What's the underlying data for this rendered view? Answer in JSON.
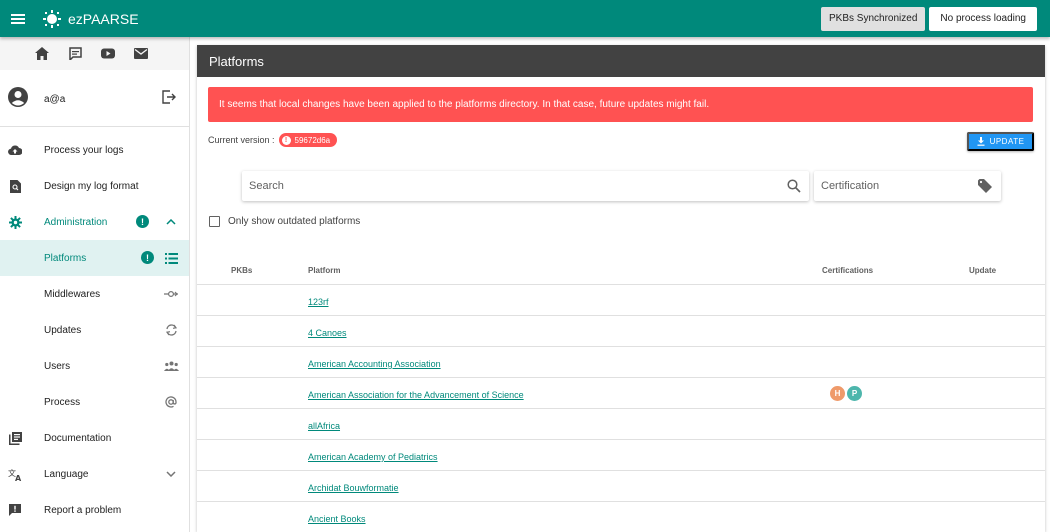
{
  "app": {
    "brand": "ezPAARSE",
    "pkbs_status": "PKBs Synchronized",
    "process_status": "No process loading"
  },
  "sidebar": {
    "user": "a@a",
    "items": [
      {
        "label": "Process your logs"
      },
      {
        "label": "Design my log format"
      },
      {
        "label": "Administration"
      },
      {
        "label": "Platforms"
      },
      {
        "label": "Middlewares"
      },
      {
        "label": "Updates"
      },
      {
        "label": "Users"
      },
      {
        "label": "Process"
      },
      {
        "label": "Documentation"
      },
      {
        "label": "Language"
      },
      {
        "label": "Report a problem"
      }
    ],
    "alert_mark": "!"
  },
  "main": {
    "title": "Platforms",
    "alert": "It seems that local changes have been applied to the platforms directory. In that case, future updates might fail.",
    "version_label": "Current version :",
    "version": "59672d6a",
    "version_mark": "!",
    "update_button": "UPDATE",
    "search_placeholder": "Search",
    "certification_placeholder": "Certification",
    "outdated_label": "Only show outdated platforms",
    "columns": {
      "pkbs": "PKBs",
      "platform": "Platform",
      "certifications": "Certifications",
      "update": "Update"
    },
    "rows": [
      {
        "platform": "123rf",
        "certs": []
      },
      {
        "platform": "4 Canoes",
        "certs": []
      },
      {
        "platform": "American Accounting Association",
        "certs": []
      },
      {
        "platform": "American Association for the Advancement of Science",
        "certs": [
          {
            "letter": "H",
            "color": "#ef9a6a"
          },
          {
            "letter": "P",
            "color": "#4db6ac"
          }
        ]
      },
      {
        "platform": "allAfrica",
        "certs": []
      },
      {
        "platform": "American Academy of Pediatrics",
        "certs": []
      },
      {
        "platform": "Archidat Bouwformatie",
        "certs": []
      },
      {
        "platform": "Ancient Books",
        "certs": []
      }
    ]
  },
  "colors": {
    "primary": "#00897b",
    "alert": "#ff5252",
    "update": "#2196f3",
    "header": "#424242"
  }
}
